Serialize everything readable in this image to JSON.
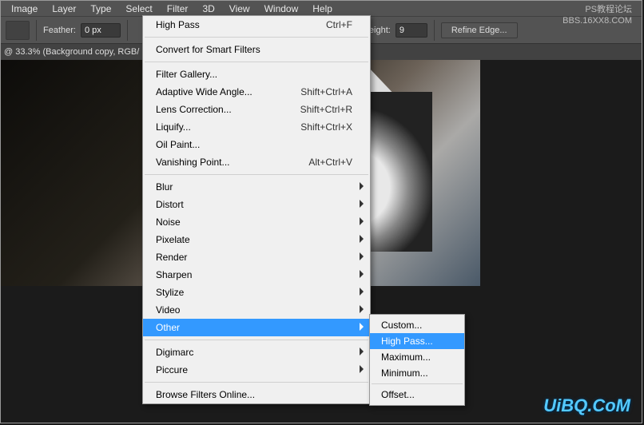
{
  "menubar": [
    "Image",
    "Layer",
    "Type",
    "Select",
    "Filter",
    "3D",
    "View",
    "Window",
    "Help"
  ],
  "toolbar": {
    "feather_label": "Feather:",
    "feather_value": "0 px",
    "height_label": "Height:",
    "height_value": "9",
    "refine_label": "Refine Edge..."
  },
  "context": "@ 33.3% (Background copy, RGB/",
  "filter_menu": {
    "top": [
      {
        "label": "High Pass",
        "shortcut": "Ctrl+F"
      }
    ],
    "group1": [
      {
        "label": "Convert for Smart Filters"
      }
    ],
    "group2": [
      {
        "label": "Filter Gallery..."
      },
      {
        "label": "Adaptive Wide Angle...",
        "shortcut": "Shift+Ctrl+A"
      },
      {
        "label": "Lens Correction...",
        "shortcut": "Shift+Ctrl+R"
      },
      {
        "label": "Liquify...",
        "shortcut": "Shift+Ctrl+X"
      },
      {
        "label": "Oil Paint..."
      },
      {
        "label": "Vanishing Point...",
        "shortcut": "Alt+Ctrl+V"
      }
    ],
    "group3": [
      {
        "label": "Blur",
        "sub": true
      },
      {
        "label": "Distort",
        "sub": true
      },
      {
        "label": "Noise",
        "sub": true
      },
      {
        "label": "Pixelate",
        "sub": true
      },
      {
        "label": "Render",
        "sub": true
      },
      {
        "label": "Sharpen",
        "sub": true
      },
      {
        "label": "Stylize",
        "sub": true
      },
      {
        "label": "Video",
        "sub": true
      },
      {
        "label": "Other",
        "sub": true,
        "hl": true
      }
    ],
    "group4": [
      {
        "label": "Digimarc",
        "sub": true
      },
      {
        "label": "Piccure",
        "sub": true
      }
    ],
    "group5": [
      {
        "label": "Browse Filters Online..."
      }
    ]
  },
  "submenu": {
    "group1": [
      {
        "label": "Custom..."
      },
      {
        "label": "High Pass...",
        "hl": true
      },
      {
        "label": "Maximum..."
      },
      {
        "label": "Minimum..."
      }
    ],
    "group2": [
      {
        "label": "Offset..."
      }
    ]
  },
  "watermark1": {
    "line1": "PS教程论坛",
    "line2": "BBS.16XX8.COM"
  },
  "watermark2": "UiBQ.CoM"
}
